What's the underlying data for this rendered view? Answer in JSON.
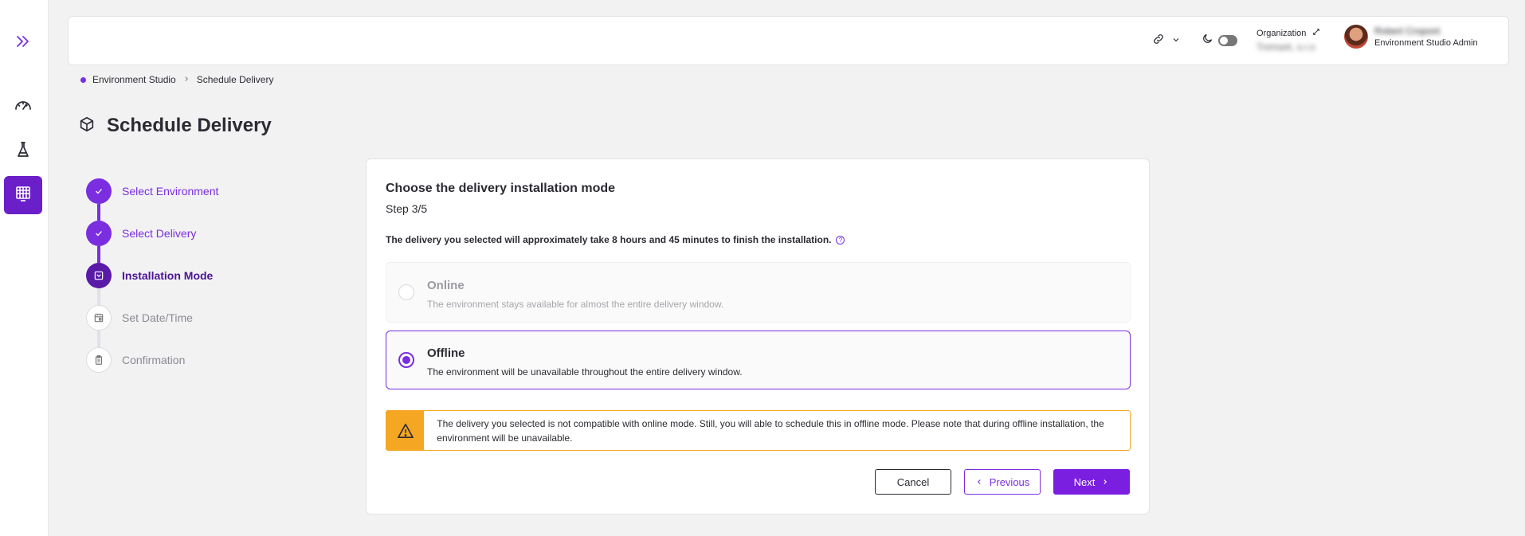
{
  "header": {
    "organization_label": "Organization",
    "organization_value": "Tremark, s.r.o",
    "user_name": "Robert Cropont",
    "user_role": "Environment Studio Admin"
  },
  "breadcrumb": {
    "items": [
      "Environment Studio",
      "Schedule Delivery"
    ]
  },
  "page": {
    "title": "Schedule Delivery"
  },
  "stepper": {
    "steps": [
      {
        "label": "Select Environment",
        "state": "done"
      },
      {
        "label": "Select Delivery",
        "state": "done"
      },
      {
        "label": "Installation Mode",
        "state": "current"
      },
      {
        "label": "Set Date/Time",
        "state": "pending"
      },
      {
        "label": "Confirmation",
        "state": "pending"
      }
    ]
  },
  "card": {
    "heading": "Choose the delivery installation mode",
    "step_text": "Step 3/5",
    "note": "The delivery you selected will approximately take 8 hours and 45 minutes to finish the installation.",
    "options": [
      {
        "title": "Online",
        "description": "The environment stays available for almost the entire delivery window.",
        "disabled": true,
        "selected": false
      },
      {
        "title": "Offline",
        "description": "The environment will be unavailable throughout the entire delivery window.",
        "disabled": false,
        "selected": true
      }
    ],
    "warning": "The delivery you selected is not compatible with online mode. Still, you will able to schedule this in offline mode. Please note that during offline installation, the environment will be unavailable.",
    "buttons": {
      "cancel": "Cancel",
      "previous": "Previous",
      "next": "Next"
    }
  },
  "colors": {
    "accent": "#7a2ee0",
    "accent_dark": "#5a1aa8",
    "warning": "#f5a623"
  },
  "icons": {
    "rail": [
      "expand-icon",
      "dashboard-gauge-icon",
      "flask-icon",
      "calendar-grid-icon"
    ],
    "header": [
      "link-icon",
      "chevron-down-icon",
      "moon-icon",
      "swap-icon"
    ],
    "title": "cube-icon",
    "warning": "warning-triangle-icon"
  }
}
